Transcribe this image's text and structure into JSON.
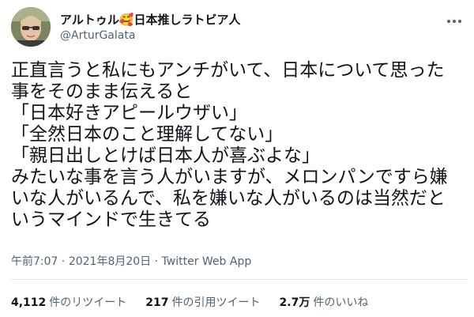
{
  "user": {
    "display_name_prefix": "アルトゥル",
    "display_name_emoji": "🥰",
    "display_name_suffix": "日本推しラトビア人",
    "handle": "@ArturGalata"
  },
  "tweet": {
    "lines": [
      "正直言うと私にもアンチがいて、日本について思った",
      "事をそのまま伝えると",
      "「日本好きアピールウザい」",
      "「全然日本のこと理解してない」",
      "「親日出しとけば日本人が喜ぶよな」",
      "みたいな事を言う人がいますが、メロンパンですら嫌",
      "いな人がいるんで、私を嫌いな人がいるのは当然だと",
      "いうマインドで生きてる"
    ],
    "time": "午前7:07",
    "separator": "·",
    "date": "2021年8月20日",
    "source": "Twitter Web App"
  },
  "stats": {
    "retweets_count": "4,112",
    "retweets_label": "件のリツイート",
    "quotes_count": "217",
    "quotes_label": "件の引用ツイート",
    "likes_count": "2.7万",
    "likes_label": "件のいいね"
  },
  "icons": {
    "more": "more-options-icon",
    "avatar": "profile-avatar"
  }
}
